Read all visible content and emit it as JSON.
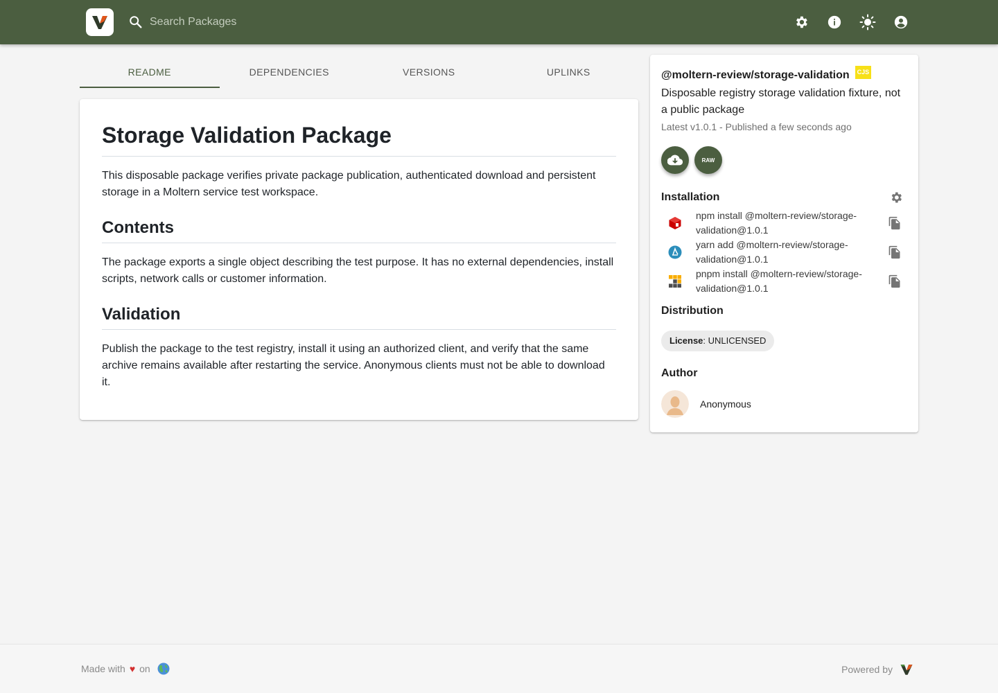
{
  "header": {
    "search_placeholder": "Search Packages",
    "icons": [
      "gear-icon",
      "info-icon",
      "sun-icon",
      "account-icon"
    ]
  },
  "tabs": [
    {
      "label": "README",
      "active": true
    },
    {
      "label": "DEPENDENCIES",
      "active": false
    },
    {
      "label": "VERSIONS",
      "active": false
    },
    {
      "label": "UPLINKS",
      "active": false
    }
  ],
  "readme": {
    "title": "Storage Validation Package",
    "intro": "This disposable package verifies private package publication, authenticated download and persistent storage in a Moltern service test workspace.",
    "sections": [
      {
        "heading": "Contents",
        "body": "The package exports a single object describing the test purpose. It has no external dependencies, install scripts, network calls or customer information."
      },
      {
        "heading": "Validation",
        "body": "Publish the package to the test registry, install it using an authorized client, and verify that the same archive remains available after restarting the service. Anonymous clients must not be able to download it."
      }
    ]
  },
  "sidebar": {
    "package_name": "@moltern-review/storage-validation",
    "module_badge": "CJS",
    "description": "Disposable registry storage validation fixture, not a public package",
    "meta": "Latest v1.0.1 - Published a few seconds ago",
    "raw_label": "RAW",
    "installation_title": "Installation",
    "installs": [
      {
        "manager": "npm",
        "command": "npm install @moltern-review/storage-validation@1.0.1"
      },
      {
        "manager": "yarn",
        "command": "yarn add @moltern-review/storage-validation@1.0.1"
      },
      {
        "manager": "pnpm",
        "command": "pnpm install @moltern-review/storage-validation@1.0.1"
      }
    ],
    "distribution_title": "Distribution",
    "license_key": "License",
    "license_value": ": UNLICENSED",
    "author_title": "Author",
    "author_name": "Anonymous"
  },
  "footer": {
    "made_with": "Made with",
    "on": "on",
    "powered_by": "Powered by"
  },
  "colors": {
    "brand": "#4b5e40",
    "badge": "#f7e018",
    "heart": "#d32f2f"
  }
}
